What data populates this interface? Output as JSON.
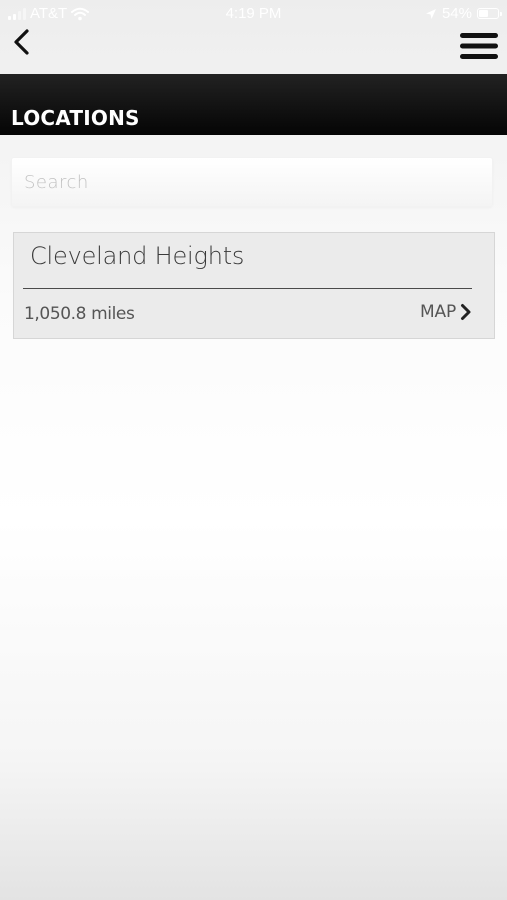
{
  "status_bar": {
    "carrier": "AT&T",
    "time": "4:19 PM",
    "battery": "54%",
    "battery_level": 0.54,
    "icons": [
      "signal-icon",
      "wifi-icon",
      "location-arrow-icon",
      "battery-icon"
    ]
  },
  "nav": {
    "back_icon": "chevron-left-icon",
    "menu_icon": "hamburger-menu-icon"
  },
  "header": {
    "title": "LOCATIONS"
  },
  "search": {
    "placeholder": "Search",
    "value": ""
  },
  "locations": [
    {
      "name": "Cleveland Heights",
      "distance": "1,050.8 miles",
      "map_label": "MAP"
    }
  ],
  "colors": {
    "header_background": "#111111",
    "card_background": "#ebebeb",
    "text_dark": "#3a3a3a",
    "text_medium": "#555555"
  }
}
